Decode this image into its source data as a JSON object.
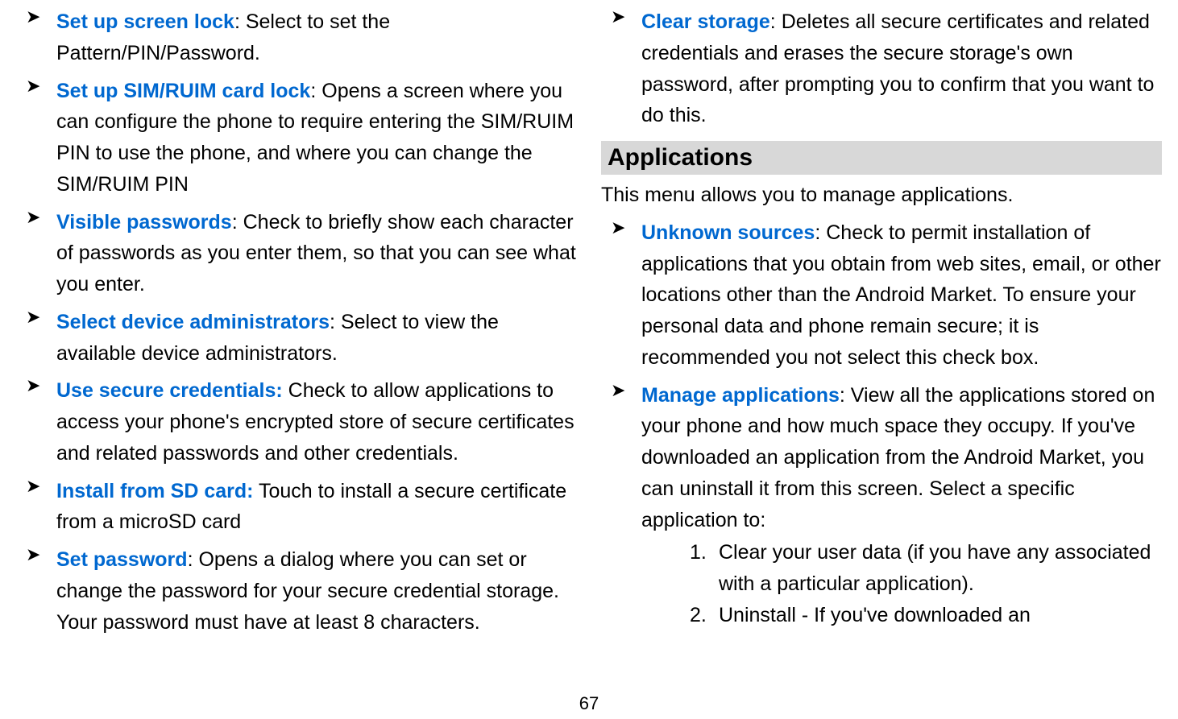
{
  "left": {
    "items": [
      {
        "label": "Set up screen lock",
        "sep": ": ",
        "text": "Select to set the Pattern/PIN/Password."
      },
      {
        "label": "Set up SIM/RUIM card lock",
        "sep": ": ",
        "text": "Opens a screen where you can configure the phone to require entering the SIM/RUIM PIN to use the phone, and where you can change the SIM/RUIM PIN"
      },
      {
        "label": "Visible passwords",
        "sep": ": ",
        "text": "Check to briefly show each character of passwords as you enter them, so that you can see what you enter."
      },
      {
        "label": "Select device administrators",
        "sep": ": ",
        "text": "Select to view the available device administrators."
      },
      {
        "label": "Use secure credentials:",
        "sep": " ",
        "text": "Check to allow applications to access your phone's encrypted store of secure certificates and related passwords and other credentials."
      },
      {
        "label": "Install from SD card:",
        "sep": " ",
        "text": "Touch to install a secure certificate from a microSD card"
      },
      {
        "label": "Set password",
        "sep": ": ",
        "text": "Opens a dialog where you can set or change the password for your secure credential storage. Your password must have at least 8 characters."
      }
    ]
  },
  "right": {
    "items_top": [
      {
        "label": "Clear storage",
        "sep": ": ",
        "text": "Deletes all secure certificates and related credentials and erases the secure storage's own password, after prompting you to confirm that you want to do this."
      }
    ],
    "heading": "Applications",
    "intro": "This menu allows you to manage applications.",
    "items_apps": [
      {
        "label": "Unknown sources",
        "sep": ": ",
        "text": "Check to permit installation of applications that you obtain from web sites, email, or other locations other than the Android Market. To ensure your personal data and phone remain secure; it is recommended you not select this check box."
      },
      {
        "label": "Manage applications",
        "sep": ": ",
        "text": "View all the applications stored on your phone and how much space they occupy. If you've downloaded an application from the Android Market, you can uninstall it from this screen. Select a specific application to:"
      }
    ],
    "numlist": [
      {
        "num": "1.",
        "text": "Clear your user data (if you have any associated with a particular application)."
      },
      {
        "num": "2.",
        "text": "Uninstall - If you've downloaded an"
      }
    ]
  },
  "pageNumber": "67"
}
